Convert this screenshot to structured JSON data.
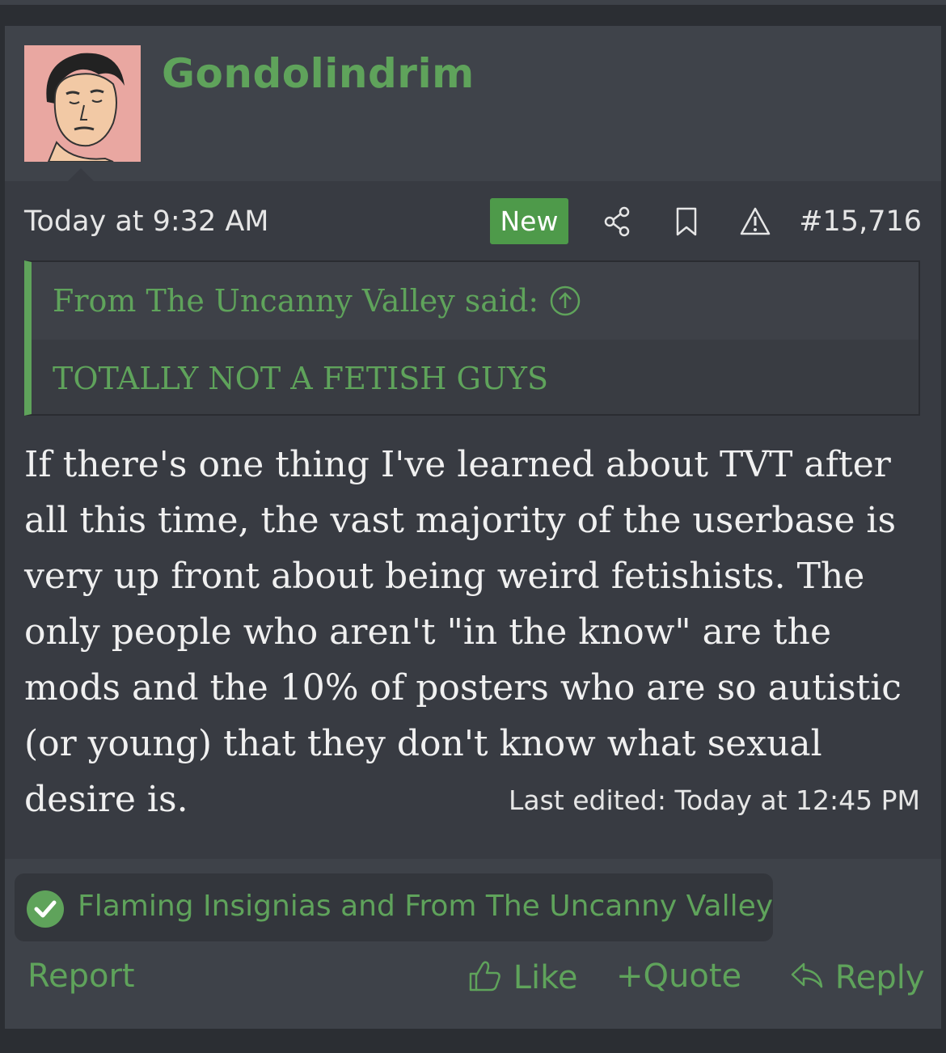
{
  "post": {
    "username": "Gondolindrim",
    "avatar_icon": "avatar-cartoon-face",
    "timestamp": "Today at 9:32 AM",
    "new_badge": "New",
    "post_number": "#15,716",
    "icons": [
      "share-icon",
      "bookmark-icon",
      "warning-icon"
    ],
    "quote": {
      "attribution": "From The Uncanny Valley said:",
      "text": "TOTALLY NOT A FETISH GUYS"
    },
    "message": "If there's one thing I've learned about TVT after all this time, the vast majority of the userbase is very up front about being weird fetishists. The only people who aren't \"in the know\" are the mods and the 10% of posters who are so autistic (or young) that they don't know what sexual desire is.",
    "last_edited": "Last edited: Today at 12:45 PM",
    "reactions": "Flaming Insignias and From The Uncanny Valley"
  },
  "actions": {
    "report": "Report",
    "like": "Like",
    "quote": "Quote",
    "reply": "Reply"
  },
  "colors": {
    "accent": "#5fa35b",
    "background": "#383b42",
    "text": "#f0f0f0"
  }
}
